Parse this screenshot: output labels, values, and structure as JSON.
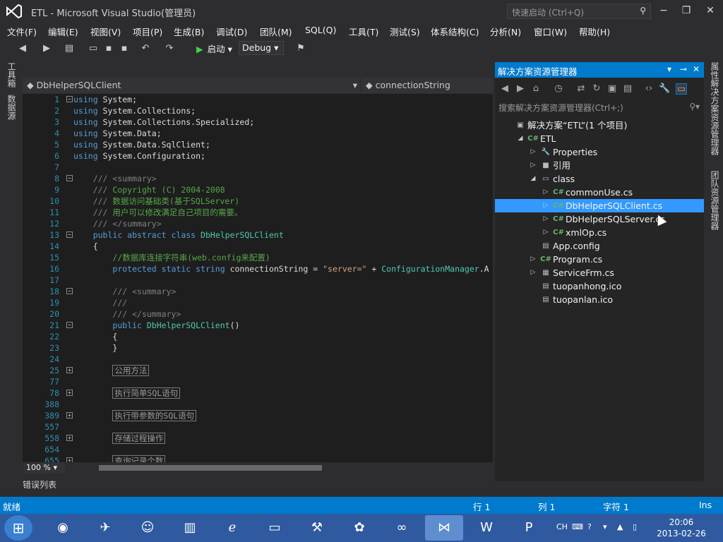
{
  "window": {
    "title": "ETL - Microsoft Visual Studio(管理员)",
    "quick_launch_placeholder": "快速启动 (Ctrl+Q)"
  },
  "menu": [
    "文件(F)",
    "编辑(E)",
    "视图(V)",
    "项目(P)",
    "生成(B)",
    "调试(D)",
    "团队(M)",
    "SQL(Q)",
    "工具(T)",
    "测试(S)",
    "体系结构(C)",
    "分析(N)",
    "窗口(W)",
    "帮助(H)"
  ],
  "toolbar": {
    "start_label": "启动",
    "config": "Debug"
  },
  "left_strip": {
    "toolbox": "工具箱",
    "datasource": "数据源"
  },
  "editor": {
    "class_dropdown": "DbHelperSQLClient",
    "member_dropdown": "connectionString",
    "zoom": "100 %",
    "lines": [
      {
        "n": "1",
        "fold": "−",
        "html": "<span class=kw>using</span> System;"
      },
      {
        "n": "2",
        "fold": "",
        "html": "<span class=kw>using</span> System.Collections;"
      },
      {
        "n": "3",
        "fold": "",
        "html": "<span class=kw>using</span> System.Collections.Specialized;"
      },
      {
        "n": "4",
        "fold": "",
        "html": "<span class=kw>using</span> System.Data;"
      },
      {
        "n": "5",
        "fold": "",
        "html": "<span class=kw>using</span> System.Data.SqlClient;"
      },
      {
        "n": "6",
        "fold": "",
        "html": "<span class=kw>using</span> System.Configuration;"
      },
      {
        "n": "7",
        "fold": "",
        "html": ""
      },
      {
        "n": "8",
        "fold": "−",
        "html": "    <span class=gr>///</span> <span class=gr>&lt;summary&gt;</span>"
      },
      {
        "n": "9",
        "fold": "",
        "html": "    <span class=gr>///</span> <span class=cm>Copyright (C) 2004-2008</span>"
      },
      {
        "n": "10",
        "fold": "",
        "html": "    <span class=gr>///</span> <span class=cm>数据访问基础类(基于SQLServer)</span>"
      },
      {
        "n": "11",
        "fold": "",
        "html": "    <span class=gr>///</span> <span class=cm>用户可以修改满足自己项目的需要。</span>"
      },
      {
        "n": "12",
        "fold": "",
        "html": "    <span class=gr>///</span> <span class=gr>&lt;/summary&gt;</span>"
      },
      {
        "n": "13",
        "fold": "−",
        "html": "    <span class=kw>public abstract class</span> <span class=tp>DbHelperSQLClient</span>"
      },
      {
        "n": "14",
        "fold": "",
        "html": "    {"
      },
      {
        "n": "15",
        "fold": "",
        "html": "        <span class=cm>//数据库连接字符串(web.config来配置)</span>"
      },
      {
        "n": "16",
        "fold": "",
        "html": "        <span class=kw>protected static string</span> connectionString = <span class=st>\"server=\"</span> + <span class=tp>ConfigurationManager</span>.A"
      },
      {
        "n": "17",
        "fold": "",
        "html": ""
      },
      {
        "n": "18",
        "fold": "−",
        "html": "        <span class=gr>///</span> <span class=gr>&lt;summary&gt;</span>"
      },
      {
        "n": "19",
        "fold": "",
        "html": "        <span class=gr>///</span>"
      },
      {
        "n": "20",
        "fold": "",
        "html": "        <span class=gr>///</span> <span class=gr>&lt;/summary&gt;</span>"
      },
      {
        "n": "21",
        "fold": "−",
        "html": "        <span class=kw>public</span> <span class=tp>DbHelperSQLClient</span>()"
      },
      {
        "n": "22",
        "fold": "",
        "html": "        {"
      },
      {
        "n": "23",
        "fold": "",
        "html": "        }"
      },
      {
        "n": "24",
        "fold": "",
        "html": ""
      },
      {
        "n": "25",
        "fold": "+",
        "html": "        <span class=region>公用方法</span>"
      },
      {
        "n": "77",
        "fold": "",
        "html": ""
      },
      {
        "n": "78",
        "fold": "+",
        "html": "        <span class=region>执行简单SQL语句</span>"
      },
      {
        "n": "388",
        "fold": "",
        "html": ""
      },
      {
        "n": "389",
        "fold": "+",
        "html": "        <span class=region>执行带参数的SQL语句</span>"
      },
      {
        "n": "557",
        "fold": "",
        "html": ""
      },
      {
        "n": "558",
        "fold": "+",
        "html": "        <span class=region>存储过程操作</span>"
      },
      {
        "n": "654",
        "fold": "",
        "html": ""
      },
      {
        "n": "655",
        "fold": "+",
        "html": "        <span class=region>查询记录个数</span>"
      }
    ]
  },
  "error_list_tab": "错误列表",
  "solution_explorer": {
    "title": "解决方案资源管理器",
    "search_placeholder": "搜索解决方案资源管理器(Ctrl+;)",
    "nodes": [
      {
        "label": "解决方案“ETL”(1 个项目)",
        "level": 0,
        "arrow": "",
        "icon": "▣",
        "cs": false,
        "sel": false
      },
      {
        "label": "ETL",
        "level": 1,
        "arrow": "◢",
        "icon": "C#",
        "cs": true,
        "sel": false
      },
      {
        "label": "Properties",
        "level": 2,
        "arrow": "▷",
        "icon": "🔧",
        "cs": false,
        "sel": false
      },
      {
        "label": "引用",
        "level": 2,
        "arrow": "▷",
        "icon": "■",
        "cs": false,
        "sel": false
      },
      {
        "label": "class",
        "level": 2,
        "arrow": "◢",
        "icon": "▭",
        "cs": false,
        "sel": false
      },
      {
        "label": "commonUse.cs",
        "level": 3,
        "arrow": "▷",
        "icon": "C#",
        "cs": true,
        "sel": false
      },
      {
        "label": "DbHelperSQLClient.cs",
        "level": 3,
        "arrow": "▷",
        "icon": "C#",
        "cs": true,
        "sel": true
      },
      {
        "label": "DbHelperSQLServer.cs",
        "level": 3,
        "arrow": "▷",
        "icon": "C#",
        "cs": true,
        "sel": false
      },
      {
        "label": "xmlOp.cs",
        "level": 3,
        "arrow": "▷",
        "icon": "C#",
        "cs": true,
        "sel": false
      },
      {
        "label": "App.config",
        "level": 2,
        "arrow": "",
        "icon": "▤",
        "cs": false,
        "sel": false
      },
      {
        "label": "Program.cs",
        "level": 2,
        "arrow": "▷",
        "icon": "C#",
        "cs": true,
        "sel": false
      },
      {
        "label": "ServiceFrm.cs",
        "level": 2,
        "arrow": "▷",
        "icon": "▦",
        "cs": false,
        "sel": false
      },
      {
        "label": "tuopanhong.ico",
        "level": 2,
        "arrow": "",
        "icon": "▤",
        "cs": false,
        "sel": false
      },
      {
        "label": "tuopanlan.ico",
        "level": 2,
        "arrow": "",
        "icon": "▤",
        "cs": false,
        "sel": false
      }
    ]
  },
  "right_strip": {
    "properties": "属性",
    "solution_explorer": "解决方案资源管理器",
    "team_explorer": "团队资源管理器"
  },
  "status": {
    "ready": "就绪",
    "line": "行 1",
    "col": "列 1",
    "char": "字符 1",
    "mode": "Ins"
  },
  "taskbar": {
    "lang": "CH",
    "time": "20:06",
    "date": "2013-02-26"
  }
}
